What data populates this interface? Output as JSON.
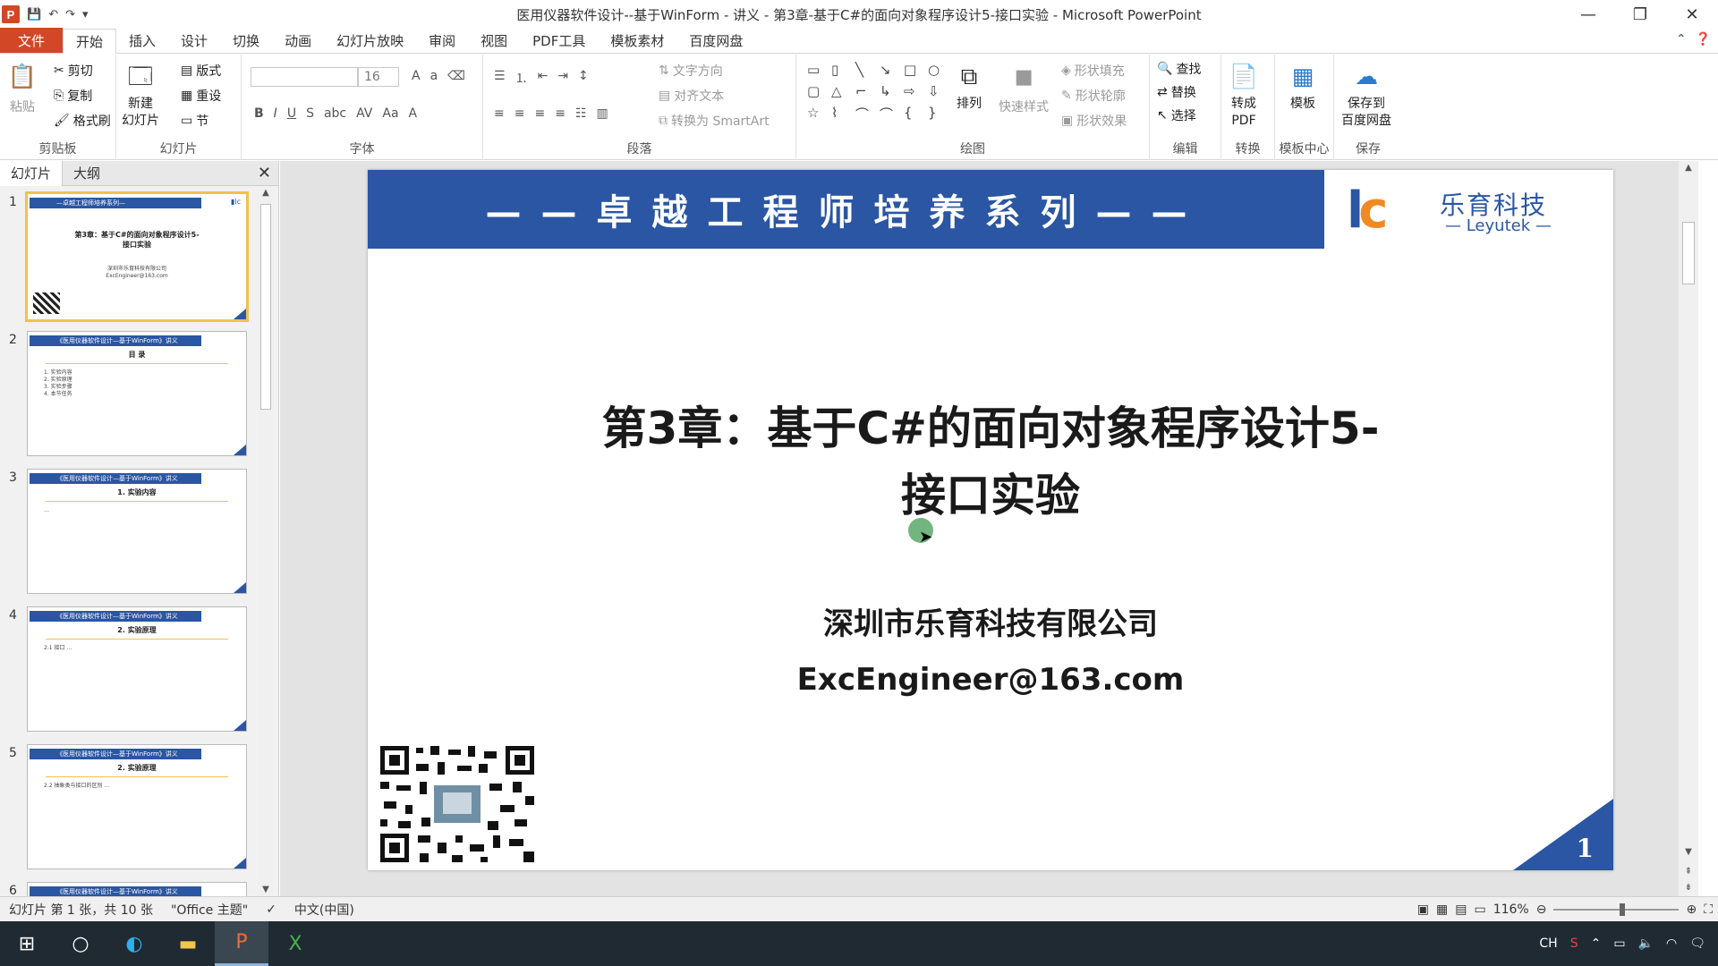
{
  "window": {
    "title": "医用仪器软件设计--基于WinForm - 讲义 - 第3章-基于C#的面向对象程序设计5-接口实验 - Microsoft PowerPoint",
    "app_icon_letter": "P",
    "minimize": "—",
    "maximize": "❐",
    "close": "✕"
  },
  "qat": {
    "save": "💾",
    "undo": "↶",
    "redo": "↷",
    "more": "▾"
  },
  "ribbon_tabs": [
    "文件",
    "开始",
    "插入",
    "设计",
    "切换",
    "动画",
    "幻灯片放映",
    "审阅",
    "视图",
    "PDF工具",
    "模板素材",
    "百度网盘"
  ],
  "ribbon": {
    "clipboard": {
      "paste": "粘贴",
      "cut": "剪切",
      "copy": "复制",
      "format_painter": "格式刷",
      "label": "剪贴板"
    },
    "slides": {
      "new_slide": "新建\n幻灯片",
      "layout": "版式",
      "reset": "重设",
      "section": "节",
      "label": "幻灯片"
    },
    "font": {
      "font_size": "16",
      "label": "字体"
    },
    "paragraph": {
      "text_direction": "文字方向",
      "align_text": "对齐文本",
      "smartart": "转换为 SmartArt",
      "label": "段落"
    },
    "drawing": {
      "arrange": "排列",
      "quick_styles": "快速样式",
      "shape_fill": "形状填充",
      "shape_outline": "形状轮廓",
      "shape_effects": "形状效果",
      "label": "绘图"
    },
    "editing": {
      "find": "查找",
      "replace": "替换",
      "select": "选择",
      "label": "编辑"
    },
    "convert": {
      "to_pdf": "转成\nPDF",
      "label": "转换"
    },
    "template": {
      "templates": "模板",
      "label": "模板中心"
    },
    "save": {
      "save_baidu": "保存到\n百度网盘",
      "label": "保存"
    }
  },
  "panel": {
    "tabs": [
      "幻灯片",
      "大纲"
    ],
    "close": "✕",
    "thumbs": [
      {
        "num": "1",
        "header": "—卓越工程师培养系列—",
        "title": "第3章：基于C#的面向对象程序设计5-\n接口实验",
        "body": "深圳市乐育科技有限公司\nExcEngineer@163.com"
      },
      {
        "num": "2",
        "header": "《医用仪器软件设计—基于WinForm》讲义",
        "title": "目 录",
        "body": "1. 实验内容\n2. 实验原理\n3. 实验步骤\n4. 本节任务"
      },
      {
        "num": "3",
        "header": "《医用仪器软件设计—基于WinForm》讲义",
        "title": "1. 实验内容",
        "body": "…"
      },
      {
        "num": "4",
        "header": "《医用仪器软件设计—基于WinForm》讲义",
        "title": "2. 实验原理",
        "body": "2.1 接口 …"
      },
      {
        "num": "5",
        "header": "《医用仪器软件设计—基于WinForm》讲义",
        "title": "2. 实验原理",
        "body": "2.2 抽象类与接口的区别 …"
      },
      {
        "num": "6",
        "header": "《医用仪器软件设计—基于WinForm》讲义",
        "title": "",
        "body": ""
      }
    ]
  },
  "slide": {
    "banner": "——卓越工程师培养系列——",
    "logo_cn": "乐育科技",
    "logo_en": "— Leyutek —",
    "title_line1": "第3章：基于C#的面向对象程序设计5-",
    "title_line2": "接口实验",
    "company": "深圳市乐育科技有限公司",
    "email": "ExcEngineer@163.com",
    "page_number": "1",
    "banner_color": "#2a56a3",
    "accent_color": "#f08a24"
  },
  "status": {
    "slide_info": "幻灯片 第 1 张，共 10 张",
    "theme": "\"Office 主题\"",
    "language": "中文(中国)",
    "zoom": "116%"
  },
  "taskbar": {
    "ime": "CH",
    "icons": [
      "windows-start-icon",
      "cortana-search-icon",
      "edge-browser-icon",
      "file-explorer-icon",
      "powerpoint-app-icon",
      "excel-app-icon"
    ]
  }
}
